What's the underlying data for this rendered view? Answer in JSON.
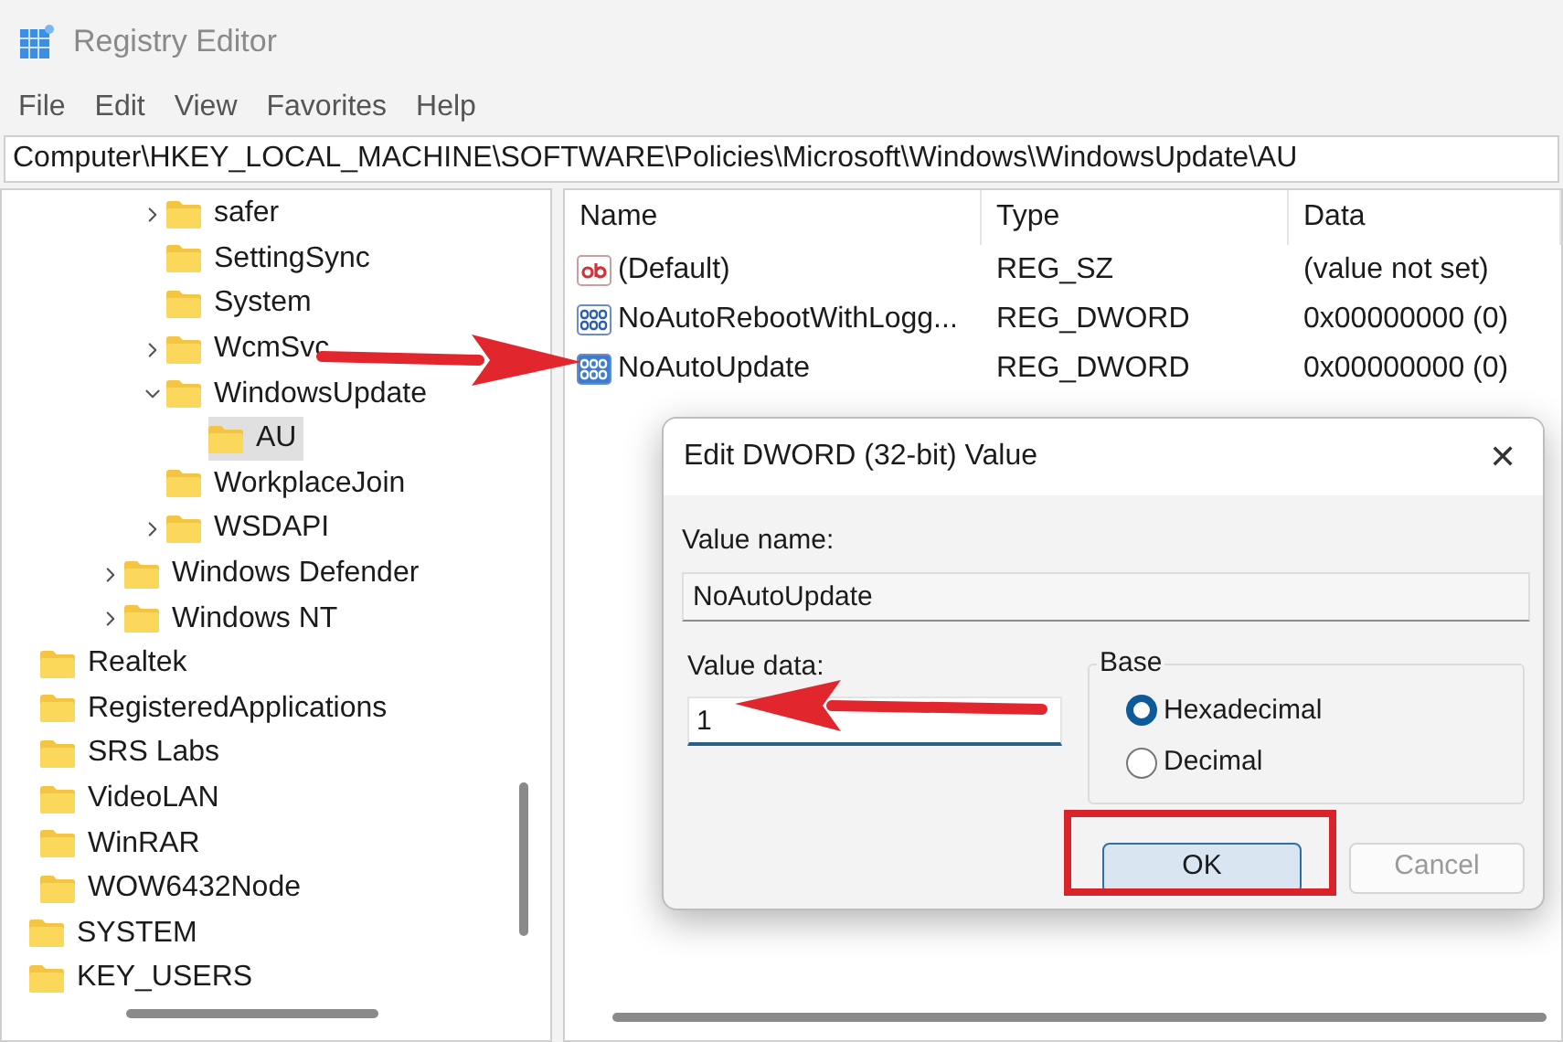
{
  "window": {
    "title": "Registry Editor"
  },
  "menu": [
    {
      "label": "File"
    },
    {
      "label": "Edit"
    },
    {
      "label": "View"
    },
    {
      "label": "Favorites"
    },
    {
      "label": "Help"
    }
  ],
  "address": "Computer\\HKEY_LOCAL_MACHINE\\SOFTWARE\\Policies\\Microsoft\\Windows\\WindowsUpdate\\AU",
  "tree": [
    {
      "children": [
        {
          "children": [
            {
              "children": [
                {
                  "children": [
                    {
                      "children": [
                        {
                          "label": "safer",
                          "expanded": false,
                          "selected": false
                        },
                        {
                          "label": "SettingSync",
                          "selected": false
                        },
                        {
                          "label": "System",
                          "selected": false
                        },
                        {
                          "label": "WcmSvc",
                          "expanded": false,
                          "selected": false
                        },
                        {
                          "label": "WindowsUpdate",
                          "expanded": true,
                          "selected": false,
                          "children": [
                            {
                              "label": "AU",
                              "selected": true
                            }
                          ]
                        },
                        {
                          "label": "WorkplaceJoin",
                          "selected": false
                        },
                        {
                          "label": "WSDAPI",
                          "expanded": false,
                          "selected": false
                        }
                      ]
                    },
                    {
                      "label": "Windows Defender",
                      "expanded": false,
                      "selected": false
                    },
                    {
                      "label": "Windows NT",
                      "expanded": false,
                      "selected": false
                    }
                  ]
                }
              ]
            },
            {
              "label": "Realtek",
              "selected": false
            },
            {
              "label": "RegisteredApplications",
              "selected": false
            },
            {
              "label": "SRS Labs",
              "selected": false
            },
            {
              "label": "VideoLAN",
              "selected": false
            },
            {
              "label": "WinRAR",
              "selected": false
            },
            {
              "label": "WOW6432Node",
              "selected": false
            }
          ]
        },
        {
          "label": "SYSTEM",
          "selected": false
        }
      ]
    },
    {
      "label": "KEY_USERS",
      "selected": false
    }
  ],
  "values": {
    "columns": [
      "Name",
      "Type",
      "Data"
    ],
    "rows": [
      {
        "kind": "string",
        "name": "(Default)",
        "type": "REG_SZ",
        "data": "(value not set)",
        "selected": false
      },
      {
        "kind": "dword",
        "name": "NoAutoRebootWithLogg...",
        "type": "REG_DWORD",
        "data": "0x00000000 (0)",
        "selected": false
      },
      {
        "kind": "dword",
        "name": "NoAutoUpdate",
        "type": "REG_DWORD",
        "data": "0x00000000 (0)",
        "selected": true
      }
    ]
  },
  "dialog": {
    "title": "Edit DWORD (32-bit) Value",
    "close": "✕",
    "value_name_label": "Value name:",
    "value_name": "NoAutoUpdate",
    "value_data_label": "Value data:",
    "value_data": "1",
    "base_label": "Base",
    "base_options": [
      {
        "label": "Hexadecimal",
        "selected": true
      },
      {
        "label": "Decimal",
        "selected": false
      }
    ],
    "buttons": [
      {
        "label": "OK",
        "default": true
      },
      {
        "label": "Cancel",
        "default": false
      }
    ]
  }
}
